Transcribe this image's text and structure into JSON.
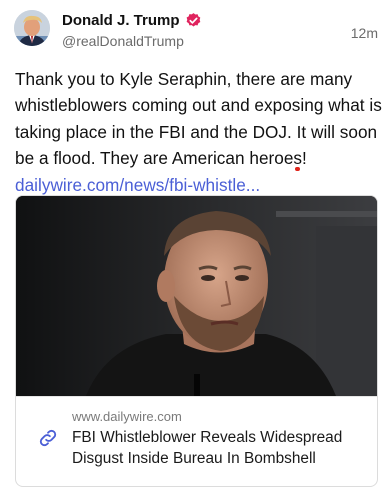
{
  "author": {
    "name": "Donald J. Trump",
    "handle": "@realDonaldTrump",
    "verified": true,
    "verified_color": "#e0245e",
    "avatar_icon": "profile-photo"
  },
  "timestamp": "12m",
  "post": {
    "text_before": "Thank you to Kyle Seraphin, there are many whistleblowers coming out and exposing what is taking place in the FBI and the DOJ. ",
    "highlighted": "It will soon be a flood.",
    "text_after": " They are American heroes! ",
    "link": "dailywire.com/news/fbi-whistle...",
    "link_color": "#4b5fd6",
    "highlight_color": "#e0241b"
  },
  "card": {
    "image_icon": "man-portrait-photo",
    "domain": "www.dailywire.com",
    "title": "FBI Whistleblower Reveals Widespread Disgust Inside Bureau In Bombshell",
    "link_icon": "link-icon"
  }
}
